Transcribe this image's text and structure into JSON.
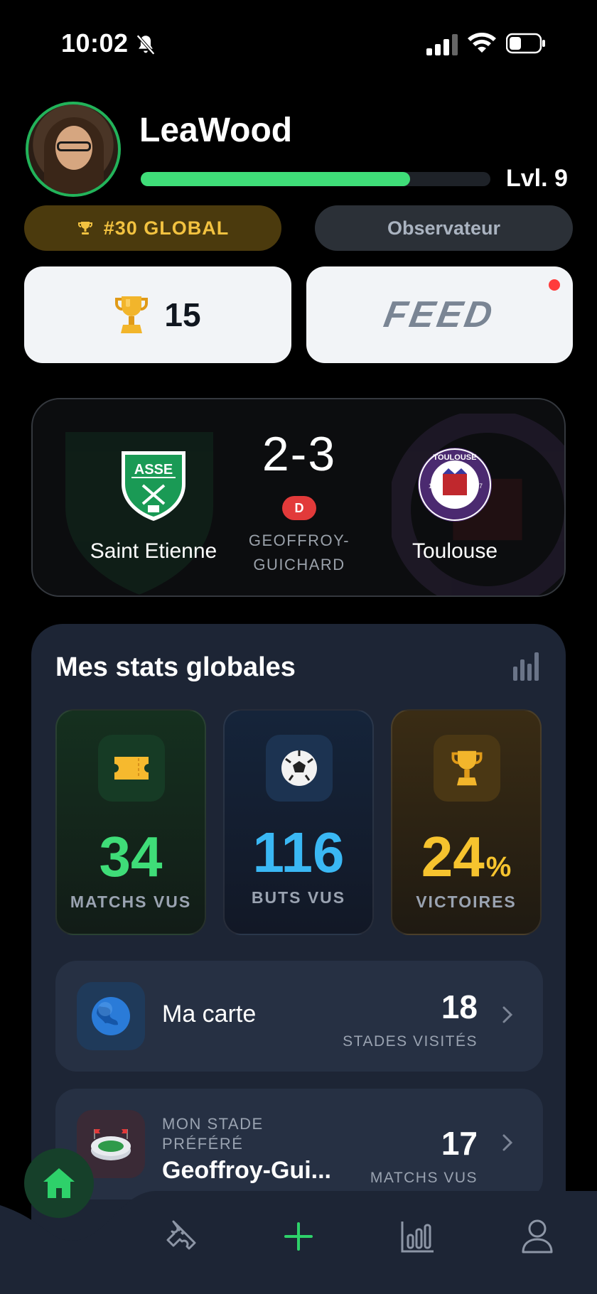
{
  "status_bar": {
    "time": "10:02"
  },
  "profile": {
    "username": "LeaWood",
    "level_label": "Lvl. 9",
    "xp_progress": 0.77,
    "rank_label": "#30 GLOBAL",
    "role_label": "Observateur"
  },
  "shortcuts": {
    "trophies_count": "15",
    "feed_label": "FEED"
  },
  "last_match": {
    "home_team": "Saint Etienne",
    "away_team": "Toulouse",
    "score": "2-3",
    "result_badge": "D",
    "stadium": "GEOFFROY-GUICHARD"
  },
  "stats": {
    "title": "Mes stats globales",
    "tiles": [
      {
        "value": "34",
        "unit": "",
        "label": "MATCHS VUS",
        "icon": "ticket-icon"
      },
      {
        "value": "116",
        "unit": "",
        "label": "BUTS VUS",
        "icon": "soccer-ball-icon"
      },
      {
        "value": "24",
        "unit": "%",
        "label": "VICTOIRES",
        "icon": "trophy-icon"
      }
    ],
    "map_row": {
      "title": "Ma carte",
      "value": "18",
      "sub": "STADES VISITÉS"
    },
    "stadium_row": {
      "kicker": "MON STADE PRÉFÉRÉ",
      "name": "Geoffroy-Gui...",
      "value": "17",
      "sub": "MATCHS VUS"
    }
  },
  "colors": {
    "accent_green": "#3fdd78",
    "accent_blue": "#3ab8f4",
    "accent_gold": "#f6c32e",
    "defeat_red": "#e23a3a"
  }
}
